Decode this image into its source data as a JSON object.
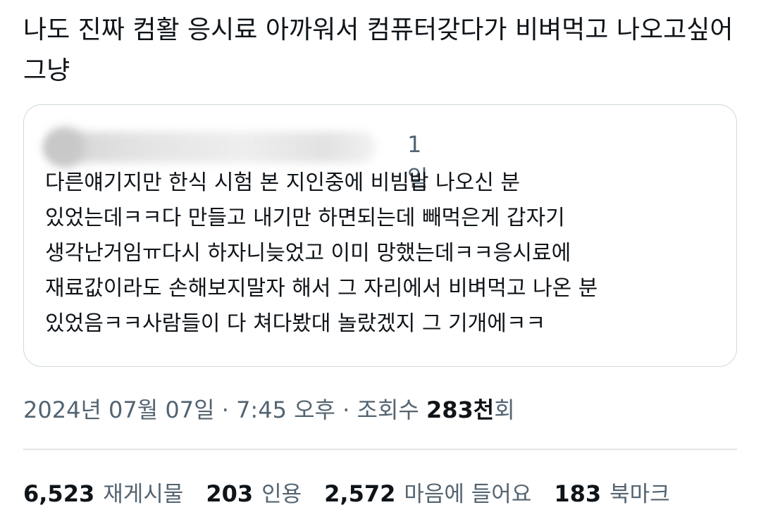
{
  "tweet": {
    "text": "나도 진짜 컴활 응시료 아까워서 컴퓨터갖다가 비벼먹고 나오고싶어그냥"
  },
  "quote": {
    "time": "1일",
    "lines": [
      "다른얘기지만 한식 시험 본 지인중에 비빔밥 나오신 분",
      "있었는데ㅋㅋ다 만들고 내기만 하면되는데 빼먹은게 갑자기",
      "생각난거임ㅠ다시 하자니늦었고 이미 망했는데ㅋㅋ응시료에",
      "재료값이라도 손해보지말자 해서 그 자리에서 비벼먹고 나온 분",
      "있었음ㅋㅋ사람들이 다 쳐다봤대 놀랐겠지 그 기개에ㅋㅋ"
    ]
  },
  "meta": {
    "date": "2024년 07월 07일",
    "sep1": " · ",
    "time": "7:45 오후",
    "sep2": " · ",
    "views_label": "조회수 ",
    "views_count": "283천",
    "views_suffix": "회"
  },
  "stats": {
    "reposts": {
      "count": "6,523",
      "label": "재게시물"
    },
    "quotes": {
      "count": "203",
      "label": "인용"
    },
    "likes": {
      "count": "2,572",
      "label": "마음에 들어요"
    },
    "bookmarks": {
      "count": "183",
      "label": "북마크"
    }
  },
  "colors": {
    "text_primary": "#0f1419",
    "text_secondary": "#536471",
    "border": "#cfd9de"
  }
}
